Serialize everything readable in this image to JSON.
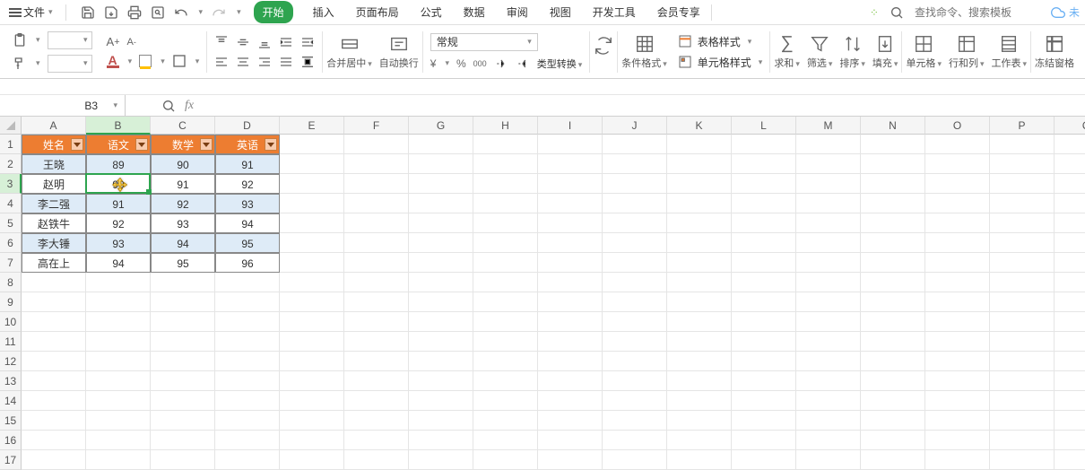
{
  "menubar": {
    "file": "文件",
    "tabs": [
      "开始",
      "插入",
      "页面布局",
      "公式",
      "数据",
      "审阅",
      "视图",
      "开发工具",
      "会员专享"
    ],
    "active_tab": 0,
    "search_placeholder": "查找命令、搜索模板",
    "cloud": "未"
  },
  "ribbon": {
    "merge": "合并居中",
    "wrap": "自动换行",
    "numfmt": "常规",
    "typeconv": "类型转换",
    "condfmt": "条件格式",
    "tablestyle": "表格样式",
    "cellstyle": "单元格样式",
    "sum": "求和",
    "filter": "筛选",
    "sort": "排序",
    "fill": "填充",
    "cell": "单元格",
    "rowcol": "行和列",
    "sheet": "工作表",
    "freeze": "冻结窗格",
    "currency": "¥",
    "percent": "%",
    "comma": "000"
  },
  "formula_bar": {
    "name": "B3",
    "fx": "fx"
  },
  "columns": [
    "A",
    "B",
    "C",
    "D",
    "E",
    "F",
    "G",
    "H",
    "I",
    "J",
    "K",
    "L",
    "M",
    "N",
    "O",
    "P",
    "Q"
  ],
  "total_rows": 17,
  "selected_col": 1,
  "selected_row": 2,
  "table": {
    "headers": [
      "姓名",
      "语文",
      "数学",
      "英语"
    ],
    "rows": [
      [
        "王晓",
        "89",
        "90",
        "91"
      ],
      [
        "赵明",
        "90",
        "91",
        "92"
      ],
      [
        "李二强",
        "91",
        "92",
        "93"
      ],
      [
        "赵铁牛",
        "92",
        "93",
        "94"
      ],
      [
        "李大锤",
        "93",
        "94",
        "95"
      ],
      [
        "高在上",
        "94",
        "95",
        "96"
      ]
    ]
  },
  "chart_data": {
    "type": "table",
    "headers": [
      "姓名",
      "语文",
      "数学",
      "英语"
    ],
    "rows": [
      [
        "王晓",
        89,
        90,
        91
      ],
      [
        "赵明",
        90,
        91,
        92
      ],
      [
        "李二强",
        91,
        92,
        93
      ],
      [
        "赵铁牛",
        92,
        93,
        94
      ],
      [
        "李大锤",
        93,
        94,
        95
      ],
      [
        "高在上",
        94,
        95,
        96
      ]
    ]
  }
}
